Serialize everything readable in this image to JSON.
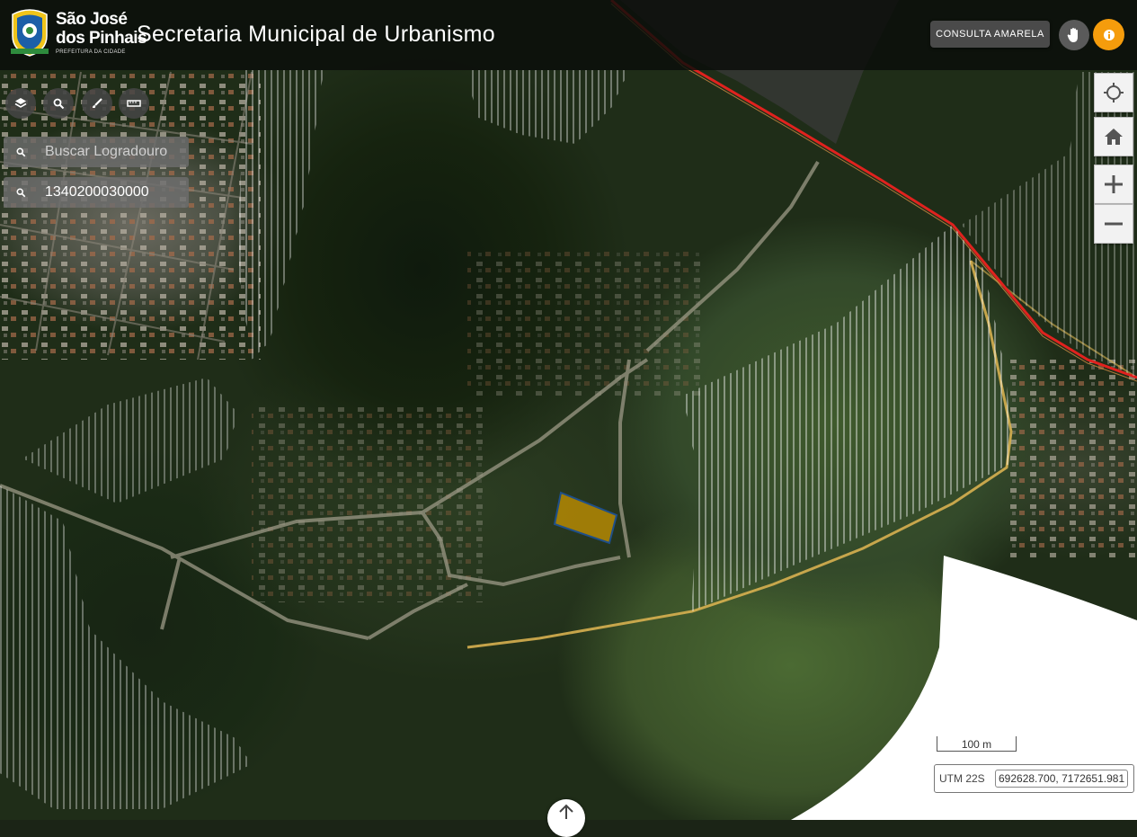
{
  "header": {
    "logo": {
      "line1": "São José",
      "line2": "dos Pinhais",
      "tagline": "PREFEITURA DA CIDADE"
    },
    "title": "Secretaria Municipal de Urbanismo",
    "consulta_label": "CONSULTA AMARELA",
    "pan_icon": "hand-icon",
    "info_icon": "info-icon",
    "accent": "#f59c0c"
  },
  "tools": {
    "layers_icon": "layers-icon",
    "search_icon": "search-icon",
    "draw_icon": "brush-icon",
    "measure_icon": "ruler-icon"
  },
  "search": {
    "street_placeholder": "Buscar Logradouro",
    "lot_value": "1340200030000"
  },
  "map_controls": [
    "locate-icon",
    "home-icon",
    "plus-icon",
    "minus-icon"
  ],
  "scale": {
    "label": "100 m"
  },
  "coords": {
    "label": "UTM 22S",
    "value": "692628.700, 7172651.981"
  },
  "colors": {
    "highlight_fill": "#c89400",
    "highlight_stroke": "#1e4f8a",
    "road_red": "#e0221e"
  }
}
